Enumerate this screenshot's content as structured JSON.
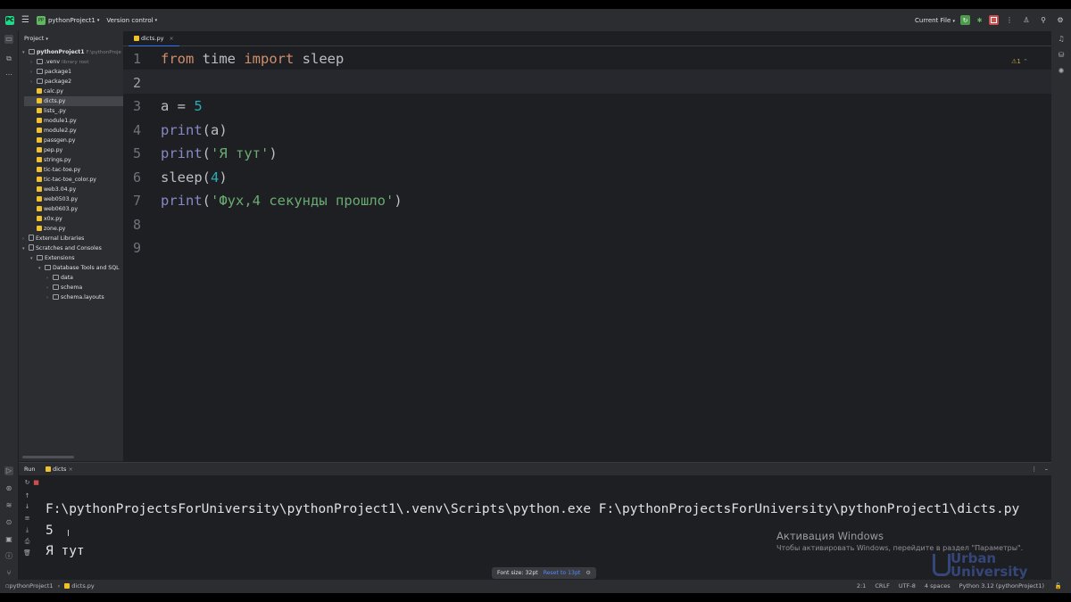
{
  "titlebar": {
    "project_badge": "PP",
    "project_name": "pythonProject1",
    "vcs": "Version control",
    "run_config": "Current File"
  },
  "project_panel": {
    "title": "Project",
    "tree": [
      {
        "label": "pythonProject1",
        "hint": "F:\\pythonProje",
        "kind": "folder"
      },
      {
        "label": ".venv",
        "hint": "library root",
        "kind": "folder"
      },
      {
        "label": "package1",
        "kind": "folder"
      },
      {
        "label": "package2",
        "kind": "folder"
      },
      {
        "label": "calc.py",
        "kind": "py"
      },
      {
        "label": "dicts.py",
        "kind": "py"
      },
      {
        "label": "lists_.py",
        "kind": "py"
      },
      {
        "label": "module1.py",
        "kind": "py"
      },
      {
        "label": "module2.py",
        "kind": "py"
      },
      {
        "label": "passgen.py",
        "kind": "py"
      },
      {
        "label": "pep.py",
        "kind": "py"
      },
      {
        "label": "strings.py",
        "kind": "py"
      },
      {
        "label": "tic-tac-toe.py",
        "kind": "py"
      },
      {
        "label": "tic-tac-toe_color.py",
        "kind": "py"
      },
      {
        "label": "web3.04.py",
        "kind": "py"
      },
      {
        "label": "web0503.py",
        "kind": "py"
      },
      {
        "label": "web0603.py",
        "kind": "py"
      },
      {
        "label": "x0x.py",
        "kind": "py"
      },
      {
        "label": "zone.py",
        "kind": "py"
      },
      {
        "label": "External Libraries",
        "kind": "lib"
      },
      {
        "label": "Scratches and Consoles",
        "kind": "scratch"
      },
      {
        "label": "Extensions",
        "kind": "folder"
      },
      {
        "label": "Database Tools and SQL",
        "kind": "folder"
      },
      {
        "label": "data",
        "kind": "folder"
      },
      {
        "label": "schema",
        "kind": "folder"
      },
      {
        "label": "schema.layouts",
        "kind": "folder"
      }
    ]
  },
  "editor": {
    "tab_label": "dicts.py",
    "warning_count": "1",
    "line_numbers": [
      "1",
      "2",
      "3",
      "4",
      "5",
      "6",
      "7",
      "8",
      "9"
    ],
    "code": {
      "l1_kw1": "from",
      "l1_mod": " time ",
      "l1_kw2": "import",
      "l1_name": " sleep",
      "l3_var": "a = ",
      "l3_num": "5",
      "l4_fn": "print",
      "l4_rest": "(a)",
      "l5_fn": "print",
      "l5_open": "(",
      "l5_str": "'Я тут'",
      "l5_close": ")",
      "l6_fn": "sleep",
      "l6_open": "(",
      "l6_num": "4",
      "l6_close": ")",
      "l7_fn": "print",
      "l7_open": "(",
      "l7_str": "'Фух,4 секунды прошло'",
      "l7_close": ")"
    }
  },
  "run_panel": {
    "title": "Run",
    "tab_label": "dicts",
    "output": [
      "F:\\pythonProjectsForUniversity\\pythonProject1\\.venv\\Scripts\\python.exe F:\\pythonProjectsForUniversity\\pythonProject1\\dicts.py",
      "5",
      "Я тут"
    ],
    "font_popup": "Font size: 32pt",
    "font_reset": "Reset to 13pt"
  },
  "overlay": {
    "activation_title": "Активация Windows",
    "activation_text": "Чтобы активировать Windows, перейдите в раздел \"Параметры\".",
    "watermark_line1": "Urban",
    "watermark_line2": "University"
  },
  "statusbar": {
    "breadcrumb_project": "pythonProject1",
    "breadcrumb_file": "dicts.py",
    "position": "2:1",
    "line_sep": "CRLF",
    "encoding": "UTF-8",
    "indent": "4 spaces",
    "interpreter": "Python 3.12 (pythonProject1)"
  },
  "colors": {
    "accent": "#3574f0",
    "keyword": "#cf8e6d",
    "string": "#6aab73",
    "number": "#2aacb8",
    "builtin": "#8888c6"
  }
}
